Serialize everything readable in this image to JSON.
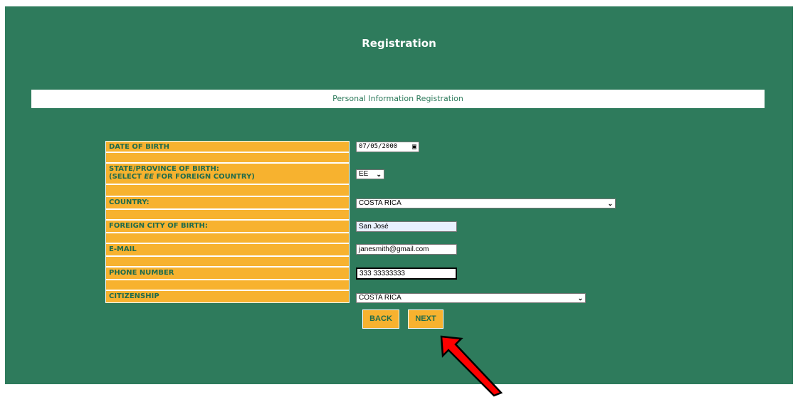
{
  "page": {
    "title": "Registration",
    "subtitle": "Personal Information Registration"
  },
  "form": {
    "dob": {
      "label": "DATE OF BIRTH",
      "value": "07/05/2000"
    },
    "state": {
      "label_line1": "STATE/PROVINCE OF BIRTH:",
      "label_line2_prefix": "(SELECT ",
      "label_line2_em": "EE",
      "label_line2_suffix": " FOR FOREIGN COUNTRY)",
      "value": "EE"
    },
    "country": {
      "label": "COUNTRY:",
      "value": "COSTA RICA"
    },
    "city": {
      "label": "FOREIGN CITY OF BIRTH:",
      "value": "San José"
    },
    "email": {
      "label": "E-MAIL",
      "value": "janesmith@gmail.com"
    },
    "phone": {
      "label": "PHONE NUMBER",
      "value": "333 33333333"
    },
    "citizenship": {
      "label": "CITIZENSHIP",
      "value": "COSTA RICA"
    }
  },
  "buttons": {
    "back": "BACK",
    "next": "NEXT"
  },
  "icons": {
    "calendar": "calendar-icon",
    "chevron": "chevron-down-icon",
    "arrow": "red-arrow-annotation"
  },
  "colors": {
    "background": "#2e7b5c",
    "label_bg": "#f7b22f",
    "label_text": "#1e6b4c",
    "arrow": "#ff0000"
  }
}
